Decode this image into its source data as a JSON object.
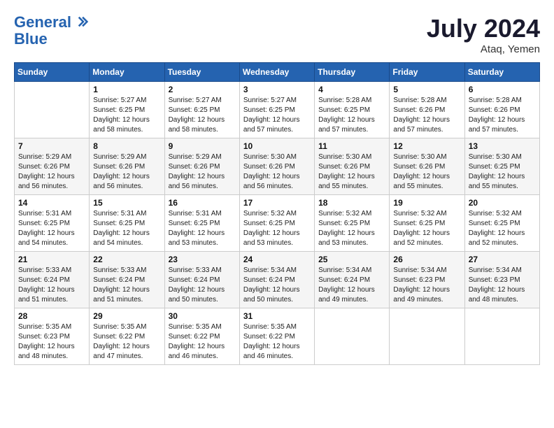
{
  "header": {
    "logo_line1": "General",
    "logo_line2": "Blue",
    "month_title": "July 2024",
    "location": "Ataq, Yemen"
  },
  "days_of_week": [
    "Sunday",
    "Monday",
    "Tuesday",
    "Wednesday",
    "Thursday",
    "Friday",
    "Saturday"
  ],
  "weeks": [
    [
      {
        "num": "",
        "info": ""
      },
      {
        "num": "1",
        "info": "Sunrise: 5:27 AM\nSunset: 6:25 PM\nDaylight: 12 hours\nand 58 minutes."
      },
      {
        "num": "2",
        "info": "Sunrise: 5:27 AM\nSunset: 6:25 PM\nDaylight: 12 hours\nand 58 minutes."
      },
      {
        "num": "3",
        "info": "Sunrise: 5:27 AM\nSunset: 6:25 PM\nDaylight: 12 hours\nand 57 minutes."
      },
      {
        "num": "4",
        "info": "Sunrise: 5:28 AM\nSunset: 6:25 PM\nDaylight: 12 hours\nand 57 minutes."
      },
      {
        "num": "5",
        "info": "Sunrise: 5:28 AM\nSunset: 6:26 PM\nDaylight: 12 hours\nand 57 minutes."
      },
      {
        "num": "6",
        "info": "Sunrise: 5:28 AM\nSunset: 6:26 PM\nDaylight: 12 hours\nand 57 minutes."
      }
    ],
    [
      {
        "num": "7",
        "info": "Sunrise: 5:29 AM\nSunset: 6:26 PM\nDaylight: 12 hours\nand 56 minutes."
      },
      {
        "num": "8",
        "info": "Sunrise: 5:29 AM\nSunset: 6:26 PM\nDaylight: 12 hours\nand 56 minutes."
      },
      {
        "num": "9",
        "info": "Sunrise: 5:29 AM\nSunset: 6:26 PM\nDaylight: 12 hours\nand 56 minutes."
      },
      {
        "num": "10",
        "info": "Sunrise: 5:30 AM\nSunset: 6:26 PM\nDaylight: 12 hours\nand 56 minutes."
      },
      {
        "num": "11",
        "info": "Sunrise: 5:30 AM\nSunset: 6:26 PM\nDaylight: 12 hours\nand 55 minutes."
      },
      {
        "num": "12",
        "info": "Sunrise: 5:30 AM\nSunset: 6:26 PM\nDaylight: 12 hours\nand 55 minutes."
      },
      {
        "num": "13",
        "info": "Sunrise: 5:30 AM\nSunset: 6:25 PM\nDaylight: 12 hours\nand 55 minutes."
      }
    ],
    [
      {
        "num": "14",
        "info": "Sunrise: 5:31 AM\nSunset: 6:25 PM\nDaylight: 12 hours\nand 54 minutes."
      },
      {
        "num": "15",
        "info": "Sunrise: 5:31 AM\nSunset: 6:25 PM\nDaylight: 12 hours\nand 54 minutes."
      },
      {
        "num": "16",
        "info": "Sunrise: 5:31 AM\nSunset: 6:25 PM\nDaylight: 12 hours\nand 53 minutes."
      },
      {
        "num": "17",
        "info": "Sunrise: 5:32 AM\nSunset: 6:25 PM\nDaylight: 12 hours\nand 53 minutes."
      },
      {
        "num": "18",
        "info": "Sunrise: 5:32 AM\nSunset: 6:25 PM\nDaylight: 12 hours\nand 53 minutes."
      },
      {
        "num": "19",
        "info": "Sunrise: 5:32 AM\nSunset: 6:25 PM\nDaylight: 12 hours\nand 52 minutes."
      },
      {
        "num": "20",
        "info": "Sunrise: 5:32 AM\nSunset: 6:25 PM\nDaylight: 12 hours\nand 52 minutes."
      }
    ],
    [
      {
        "num": "21",
        "info": "Sunrise: 5:33 AM\nSunset: 6:24 PM\nDaylight: 12 hours\nand 51 minutes."
      },
      {
        "num": "22",
        "info": "Sunrise: 5:33 AM\nSunset: 6:24 PM\nDaylight: 12 hours\nand 51 minutes."
      },
      {
        "num": "23",
        "info": "Sunrise: 5:33 AM\nSunset: 6:24 PM\nDaylight: 12 hours\nand 50 minutes."
      },
      {
        "num": "24",
        "info": "Sunrise: 5:34 AM\nSunset: 6:24 PM\nDaylight: 12 hours\nand 50 minutes."
      },
      {
        "num": "25",
        "info": "Sunrise: 5:34 AM\nSunset: 6:24 PM\nDaylight: 12 hours\nand 49 minutes."
      },
      {
        "num": "26",
        "info": "Sunrise: 5:34 AM\nSunset: 6:23 PM\nDaylight: 12 hours\nand 49 minutes."
      },
      {
        "num": "27",
        "info": "Sunrise: 5:34 AM\nSunset: 6:23 PM\nDaylight: 12 hours\nand 48 minutes."
      }
    ],
    [
      {
        "num": "28",
        "info": "Sunrise: 5:35 AM\nSunset: 6:23 PM\nDaylight: 12 hours\nand 48 minutes."
      },
      {
        "num": "29",
        "info": "Sunrise: 5:35 AM\nSunset: 6:22 PM\nDaylight: 12 hours\nand 47 minutes."
      },
      {
        "num": "30",
        "info": "Sunrise: 5:35 AM\nSunset: 6:22 PM\nDaylight: 12 hours\nand 46 minutes."
      },
      {
        "num": "31",
        "info": "Sunrise: 5:35 AM\nSunset: 6:22 PM\nDaylight: 12 hours\nand 46 minutes."
      },
      {
        "num": "",
        "info": ""
      },
      {
        "num": "",
        "info": ""
      },
      {
        "num": "",
        "info": ""
      }
    ]
  ]
}
